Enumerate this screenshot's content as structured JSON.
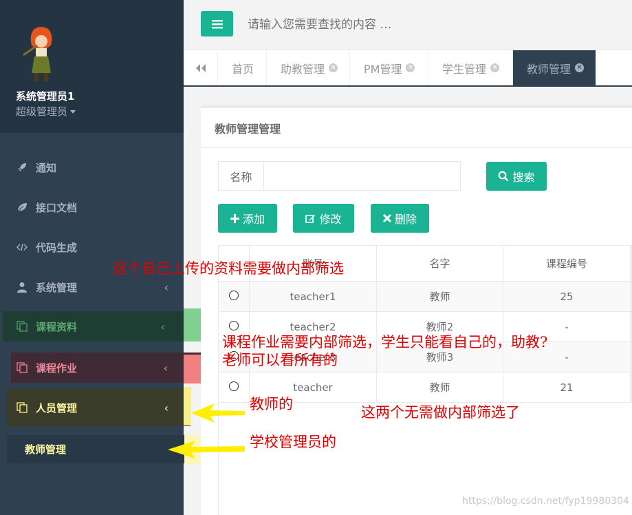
{
  "profile": {
    "name": "系统管理员1",
    "role": "超级管理员"
  },
  "sidebar": {
    "items": [
      {
        "label": "通知",
        "icon": "rocket-icon"
      },
      {
        "label": "接口文档",
        "icon": "leaf-icon"
      },
      {
        "label": "代码生成",
        "icon": "code-icon"
      },
      {
        "label": "系统管理",
        "icon": "user-icon"
      },
      {
        "label": "课程资料",
        "icon": "copy-icon"
      },
      {
        "label": "课程作业",
        "icon": "copy-icon"
      },
      {
        "label": "人员管理",
        "icon": "copy-icon"
      }
    ],
    "sub_item": "教师管理"
  },
  "topbar": {
    "search_placeholder": "请输入您需要查找的内容 …"
  },
  "tabs": [
    {
      "label": "首页",
      "closable": false
    },
    {
      "label": "助教管理",
      "closable": true
    },
    {
      "label": "PM管理",
      "closable": true
    },
    {
      "label": "学生管理",
      "closable": true
    },
    {
      "label": "教师管理",
      "closable": true,
      "active": true
    }
  ],
  "panel": {
    "title": "教师管理管理",
    "field_label": "名称",
    "search_label": "搜索",
    "add_label": "添加",
    "edit_label": "修改",
    "delete_label": "删除"
  },
  "table": {
    "headers": [
      "",
      "账号",
      "名字",
      "课程编号"
    ],
    "rows": [
      {
        "account": "teacher1",
        "name": "教师",
        "course": "25"
      },
      {
        "account": "teacher2",
        "name": "教师2",
        "course": "-"
      },
      {
        "account": "teacher3",
        "name": "教师3",
        "course": "-"
      },
      {
        "account": "teacher",
        "name": "教师",
        "course": "21"
      }
    ]
  },
  "annotations": {
    "a1": "这个自己上传的资料需要做内部筛选",
    "a2": "课程作业需要内部筛选，学生只能看自己的，助教?",
    "a3": "老师可以看所有的",
    "a4": "教师的",
    "a5": "这两个无需做内部筛选了",
    "a6": "学校管理员的"
  },
  "watermark": "https://blog.csdn.net/fyp19980304",
  "colors": {
    "sidebar": "#2f4050",
    "accent": "#1ab394",
    "annotation": "#e00000",
    "highlight_green": "#82d08f",
    "highlight_red": "#f28080",
    "highlight_yellow": "#f7f086"
  }
}
